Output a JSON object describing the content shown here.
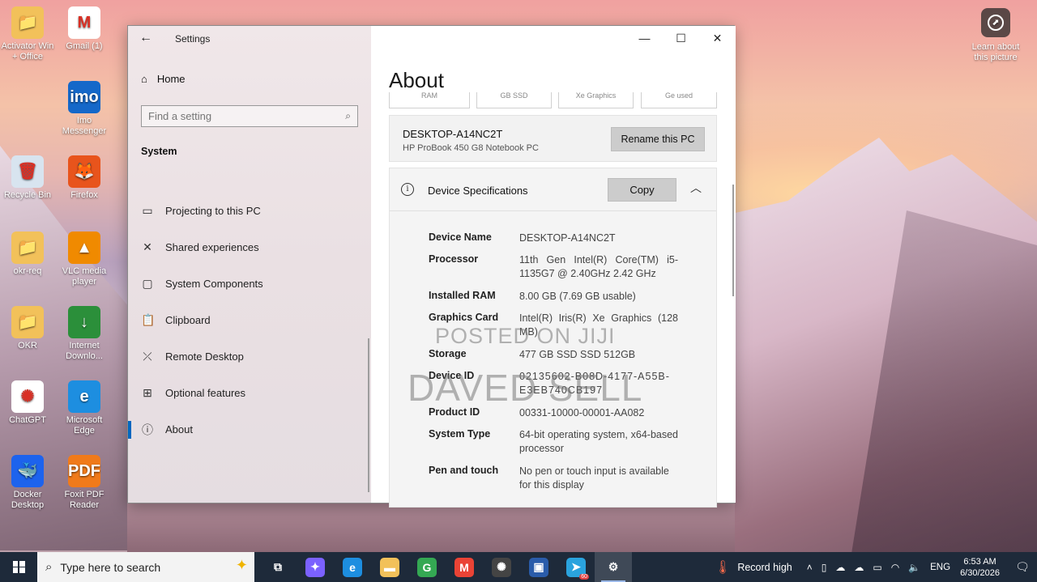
{
  "desktop": {
    "icons": [
      {
        "label": "Activator Win + Office",
        "color": "#f2c15a",
        "glyph": "📁"
      },
      {
        "label": "Gmail (1)",
        "color": "#ffffff",
        "glyph": "M"
      },
      {
        "label": "Internet Downlo...",
        "color": "#2b8f3a",
        "glyph": "↓"
      },
      {
        "label": "Imo Messenger",
        "color": "#1568c9",
        "glyph": "imo"
      },
      {
        "label": "Recycle Bin",
        "color": "#d8e4ef",
        "glyph": "🗑"
      },
      {
        "label": "Firefox",
        "color": "#e8541c",
        "glyph": "🦊"
      },
      {
        "label": "okr-req",
        "color": "#f2c15a",
        "glyph": "📁"
      },
      {
        "label": "VLC media player",
        "color": "#f08a00",
        "glyph": "▲"
      },
      {
        "label": "OKR",
        "color": "#f2c15a",
        "glyph": "📁"
      },
      {
        "label": "Internet Downlo...",
        "color": "#2b8f3a",
        "glyph": "↓"
      },
      {
        "label": "ChatGPT",
        "color": "#ffffff",
        "glyph": "✺"
      },
      {
        "label": "Microsoft Edge",
        "color": "#1d8ee0",
        "glyph": "e"
      },
      {
        "label": "Docker Desktop",
        "color": "#1d63ed",
        "glyph": "🐳"
      },
      {
        "label": "Foxit PDF Reader",
        "color": "#f07a1a",
        "glyph": "PDF"
      }
    ],
    "learn_label": "Learn about this picture"
  },
  "window": {
    "title": "Settings",
    "controls": {
      "minimize": "—",
      "maximize": "☐",
      "close": "✕"
    }
  },
  "sidebar": {
    "home_label": "Home",
    "search_placeholder": "Find a setting",
    "section": "System",
    "items": [
      {
        "label": "Projecting to this PC",
        "icon": "projector-icon"
      },
      {
        "label": "Shared experiences",
        "icon": "shared-icon"
      },
      {
        "label": "System Components",
        "icon": "components-icon"
      },
      {
        "label": "Clipboard",
        "icon": "clipboard-icon"
      },
      {
        "label": "Remote Desktop",
        "icon": "remote-icon"
      },
      {
        "label": "Optional features",
        "icon": "features-icon"
      },
      {
        "label": "About",
        "icon": "info-icon"
      }
    ]
  },
  "main": {
    "title": "About",
    "cut_boxes": [
      "RAM",
      "GB SSD",
      "Xe Graphics",
      "Ge used"
    ],
    "pc_card": {
      "name": "DESKTOP-A14NC2T",
      "model": "HP ProBook 450 G8 Notebook PC",
      "rename_label": "Rename this PC"
    },
    "specs": {
      "title": "Device Specifications",
      "copy_label": "Copy",
      "rows": [
        {
          "key": "Device Name",
          "value": "DESKTOP-A14NC2T"
        },
        {
          "key": "Processor",
          "value": "11th Gen Intel(R) Core(TM) i5-1135G7 @ 2.40GHz 2.42 GHz"
        },
        {
          "key": "Installed RAM",
          "value": "8.00 GB (7.69 GB usable)"
        },
        {
          "key": "Graphics Card",
          "value": "Intel(R) Iris(R) Xe Graphics (128 MB)"
        },
        {
          "key": "Storage",
          "value": "477 GB SSD SSD 512GB"
        },
        {
          "key": "Device ID",
          "value": "02135602-B08D-4177-A55B-E3EB740CB197"
        },
        {
          "key": "Product ID",
          "value": "00331-10000-00001-AA082"
        },
        {
          "key": "System Type",
          "value": "64-bit operating system, x64-based processor"
        },
        {
          "key": "Pen and touch",
          "value": "No pen or touch input is available for this display"
        }
      ]
    }
  },
  "watermark": {
    "line1": "POSTED ON JIJI",
    "line2": "DAVED SELL"
  },
  "taskbar": {
    "search_placeholder": "Type here to search",
    "apps": [
      {
        "name": "task-view",
        "glyph": "⧉",
        "color": "transparent"
      },
      {
        "name": "copilot",
        "glyph": "✦",
        "color": "#7b61ff"
      },
      {
        "name": "edge",
        "glyph": "e",
        "color": "#1d8ee0"
      },
      {
        "name": "file-explorer",
        "glyph": "▬",
        "color": "#f2c15a"
      },
      {
        "name": "chrome",
        "glyph": "G",
        "color": "#34a853"
      },
      {
        "name": "gmail",
        "glyph": "M",
        "color": "#ea4335"
      },
      {
        "name": "chatgpt",
        "glyph": "✺",
        "color": "#444444"
      },
      {
        "name": "display",
        "glyph": "▣",
        "color": "#2a5caa"
      },
      {
        "name": "telegram",
        "glyph": "➤",
        "color": "#2aa3de",
        "badge": "60"
      },
      {
        "name": "settings",
        "glyph": "⚙",
        "color": "transparent"
      }
    ],
    "weather": "Record high",
    "lang": "ENG",
    "time": "6:53 AM",
    "date": "6/30/2026"
  }
}
